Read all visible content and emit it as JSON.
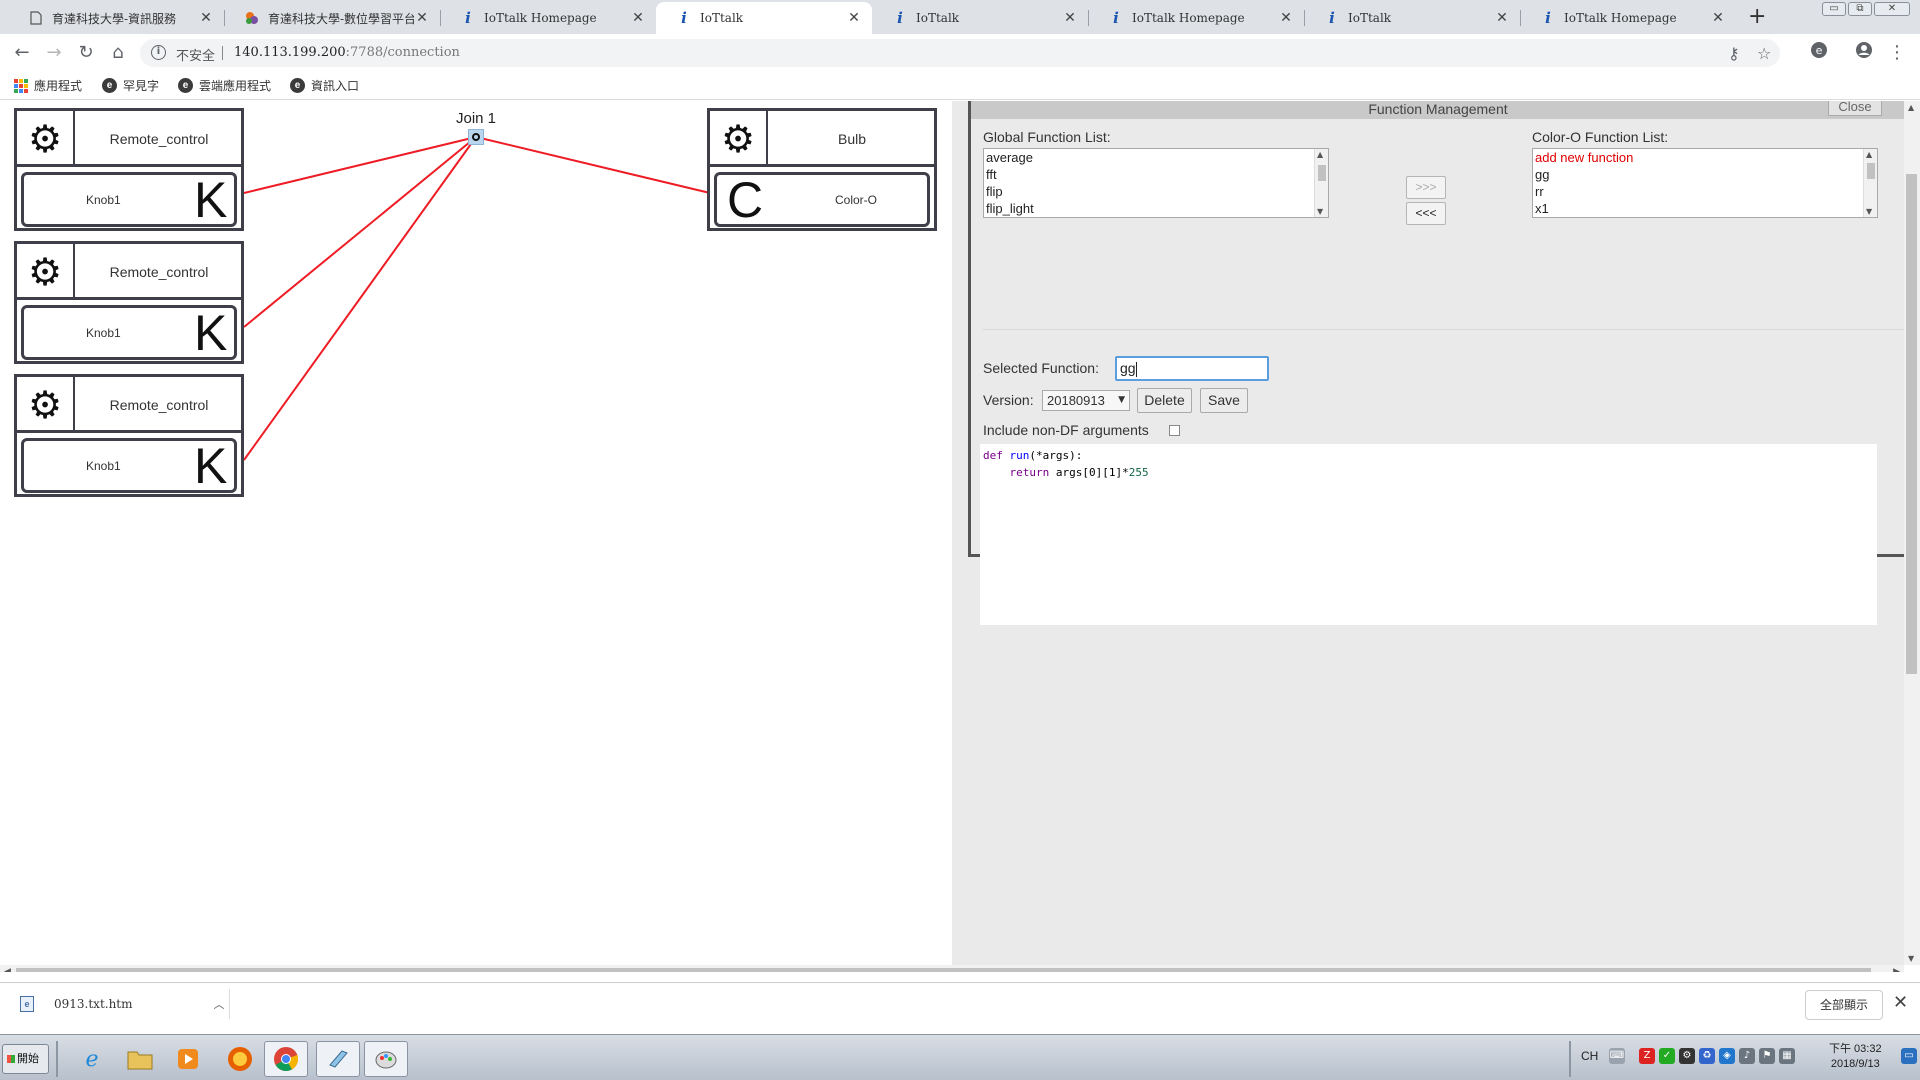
{
  "browser": {
    "tabs": [
      {
        "title": "育達科技大學-資訊服務",
        "favicon": "doc-icon",
        "active": false
      },
      {
        "title": "育達科技大學-數位學習平台",
        "favicon": "moodle-icon",
        "active": false
      },
      {
        "title": "IoTtalk Homepage",
        "favicon": "iottalk-icon",
        "active": false
      },
      {
        "title": "IoTtalk",
        "favicon": "iottalk-icon",
        "active": true
      },
      {
        "title": "IoTtalk",
        "favicon": "iottalk-icon",
        "active": false
      },
      {
        "title": "IoTtalk Homepage",
        "favicon": "iottalk-icon",
        "active": false
      },
      {
        "title": "IoTtalk",
        "favicon": "iottalk-icon",
        "active": false
      },
      {
        "title": "IoTtalk Homepage",
        "favicon": "iottalk-icon",
        "active": false
      }
    ],
    "new_tab": "+",
    "window_buttons": {
      "minimize": "▭",
      "restore": "⧉",
      "close": "✕"
    },
    "address": {
      "security_label": "不安全",
      "host": "140.113.199.200",
      "path": ":7788/connection"
    },
    "bookmarks": [
      {
        "label": "應用程式",
        "icon": "apps-grid-icon"
      },
      {
        "label": "罕見字",
        "icon": "ie-icon"
      },
      {
        "label": "雲端應用程式",
        "icon": "ie-icon"
      },
      {
        "label": "資訊入口",
        "icon": "ie-icon"
      }
    ]
  },
  "workspace": {
    "devices": [
      {
        "name": "Remote_control",
        "feature": "Knob1",
        "letter": "K",
        "side": "input"
      },
      {
        "name": "Remote_control",
        "feature": "Knob1",
        "letter": "K",
        "side": "input"
      },
      {
        "name": "Remote_control",
        "feature": "Knob1",
        "letter": "K",
        "side": "input"
      },
      {
        "name": "Bulb",
        "feature": "Color-O",
        "letter": "C",
        "side": "output"
      }
    ],
    "join": {
      "label": "Join 1"
    },
    "link_color": "#ee1c25"
  },
  "function_management": {
    "title": "Function Management",
    "close_label": "Close",
    "global_list_label": "Global Function List:",
    "global_functions": [
      "average",
      "fft",
      "flip",
      "flip_light"
    ],
    "device_list_label": "Color-O Function List:",
    "device_functions": [
      {
        "label": "add new function",
        "highlight": true
      },
      {
        "label": "gg",
        "highlight": false
      },
      {
        "label": "rr",
        "highlight": false
      },
      {
        "label": "x1",
        "highlight": false
      }
    ],
    "move_right_label": ">>>",
    "move_left_label": "<<<",
    "selected_function_label": "Selected Function:",
    "selected_function_value": "gg",
    "version_label": "Version:",
    "version_value": "20180913",
    "delete_label": "Delete",
    "save_label": "Save",
    "non_df_label": "Include non-DF arguments",
    "non_df_checked": false,
    "code": {
      "line1": {
        "kw": "def",
        "fn": "run",
        "rest": "(*args):"
      },
      "line2": {
        "indent": "    ",
        "kw": "return",
        "rest": " args[0][1]*",
        "num": "255"
      }
    }
  },
  "download_bar": {
    "file_name": "0913.txt.htm",
    "show_all_label": "全部顯示"
  },
  "taskbar": {
    "start_label": "開始",
    "apps": [
      "ie-icon",
      "folder-icon",
      "media-player-icon",
      "firefox-icon",
      "chrome-icon",
      "notepad-icon",
      "paint-icon"
    ],
    "tray": {
      "language": "CH",
      "time": "下午 03:32",
      "date": "2018/9/13"
    }
  }
}
